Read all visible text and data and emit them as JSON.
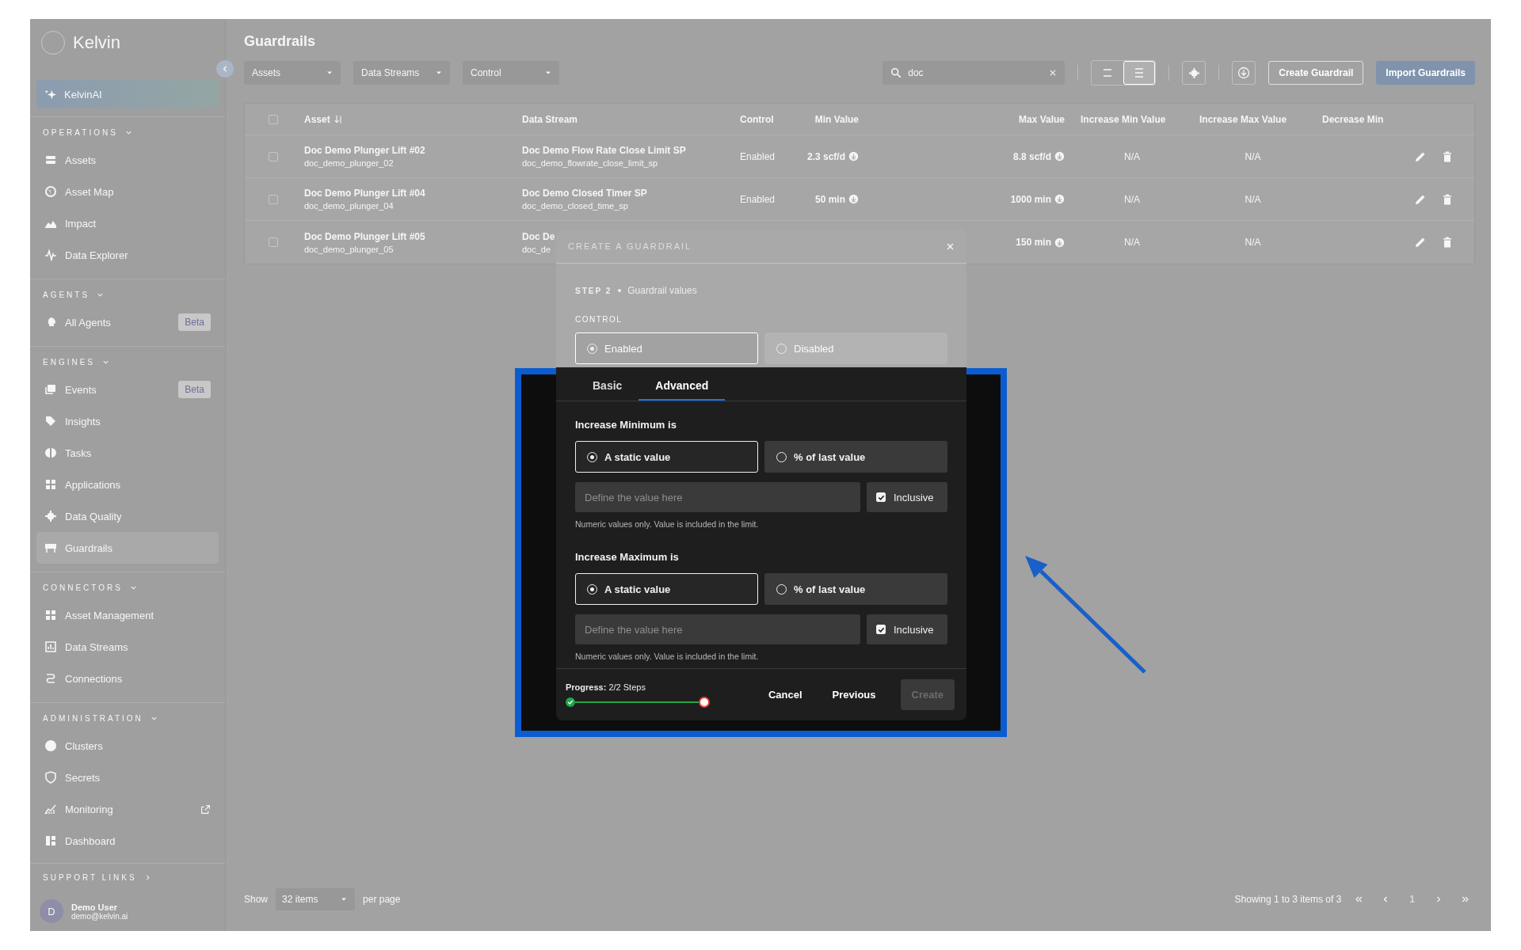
{
  "sidebar": {
    "logo": "Kelvin",
    "ai_item": {
      "label": "KelvinAI"
    },
    "sections": [
      {
        "title": "OPERATIONS",
        "items": [
          {
            "label": "Assets",
            "selected": false
          },
          {
            "label": "Asset Map",
            "selected": false
          },
          {
            "label": "Impact",
            "selected": false
          },
          {
            "label": "Data Explorer",
            "selected": false
          }
        ]
      },
      {
        "title": "AGENTS",
        "items": [
          {
            "label": "All Agents",
            "selected": false,
            "badge": "Beta"
          }
        ]
      },
      {
        "title": "ENGINES",
        "items": [
          {
            "label": "Events",
            "selected": false,
            "badge": "Beta"
          },
          {
            "label": "Insights",
            "selected": false
          },
          {
            "label": "Tasks",
            "selected": false
          },
          {
            "label": "Applications",
            "selected": false
          },
          {
            "label": "Data Quality",
            "selected": false
          },
          {
            "label": "Guardrails",
            "selected": true
          }
        ]
      },
      {
        "title": "CONNECTORS",
        "items": [
          {
            "label": "Asset Management",
            "selected": false
          },
          {
            "label": "Data Streams",
            "selected": false
          },
          {
            "label": "Connections",
            "selected": false
          }
        ]
      },
      {
        "title": "ADMINISTRATION",
        "items": [
          {
            "label": "Clusters",
            "selected": false
          },
          {
            "label": "Secrets",
            "selected": false
          },
          {
            "label": "Monitoring",
            "selected": false,
            "external": true
          },
          {
            "label": "Dashboard",
            "selected": false
          }
        ]
      }
    ],
    "support": "SUPPORT LINKS",
    "user": {
      "initial": "D",
      "name": "Demo User",
      "email": "demo@kelvin.ai"
    }
  },
  "main": {
    "title": "Guardrails",
    "filters": [
      "Assets",
      "Data Streams",
      "Control"
    ],
    "search": {
      "value": "doc"
    },
    "view_toggle": [
      {
        "selected": false
      },
      {
        "selected": true
      }
    ],
    "buttons": [
      {
        "label": "Create Guardrail",
        "kind": "outline"
      },
      {
        "label": "Import Guardrails",
        "kind": "primary"
      }
    ]
  },
  "table": {
    "header_checked": false,
    "columns": [
      "Asset",
      "Data Stream",
      "Control",
      "Min Value",
      "Max Value",
      "Increase Min Value",
      "Increase Max Value",
      "Decrease Min"
    ],
    "rows": [
      {
        "checked": false,
        "asset": "Doc Demo Plunger Lift #02",
        "asset_id": "doc_demo_plunger_02",
        "data_stream": "Doc Demo Flow Rate Close Limit SP",
        "data_stream_id": "doc_demo_flowrate_close_limit_sp",
        "control": "Enabled",
        "min_value": "2.3 scf/d",
        "max_value": "8.8 scf/d",
        "increase_min": "N/A",
        "increase_max": "N/A"
      },
      {
        "checked": false,
        "asset": "Doc Demo Plunger Lift #04",
        "asset_id": "doc_demo_plunger_04",
        "data_stream": "Doc Demo Closed Timer SP",
        "data_stream_id": "doc_demo_closed_time_sp",
        "control": "Enabled",
        "min_value": "50 min",
        "max_value": "1000 min",
        "increase_min": "N/A",
        "increase_max": "N/A"
      },
      {
        "checked": false,
        "asset": "Doc Demo Plunger Lift #05",
        "asset_id": "doc_demo_plunger_05",
        "data_stream": "Doc De",
        "data_stream_id": "doc_de",
        "max_value": "150 min",
        "increase_min": "N/A",
        "increase_max": "N/A"
      }
    ]
  },
  "pagination": {
    "show_label": "Show",
    "page_size": "32 items",
    "per_page": "per page",
    "summary": "Showing 1 to 3 items of 3",
    "pages": [
      {
        "label": "1",
        "selected": true
      }
    ]
  },
  "modal": {
    "title": "CREATE A GUARDRAIL",
    "step_label": "STEP 2",
    "step_name": "Guardrail values",
    "control": {
      "label": "CONTROL",
      "options": [
        {
          "label": "Enabled",
          "selected": true
        },
        {
          "label": "Disabled",
          "selected": false
        }
      ]
    },
    "tabs": [
      {
        "label": "Basic",
        "selected": false
      },
      {
        "label": "Advanced",
        "selected": true
      }
    ],
    "sections": [
      {
        "title": "Increase Minimum is",
        "options": [
          {
            "label": "A static value",
            "selected": true
          },
          {
            "label": "% of last value",
            "selected": false
          }
        ],
        "input": {
          "placeholder": "Define the value here"
        },
        "inclusive": {
          "label": "Inclusive",
          "checked": true
        },
        "hint": "Numeric values only. Value is included in the limit."
      },
      {
        "title": "Increase Maximum is",
        "options": [
          {
            "label": "A static value",
            "selected": true
          },
          {
            "label": "% of last value",
            "selected": false
          }
        ],
        "input": {
          "placeholder": "Define the value here"
        },
        "inclusive": {
          "label": "Inclusive",
          "checked": true
        },
        "hint": "Numeric values only. Value is included in the limit."
      }
    ],
    "footer": {
      "progress": "**Progress:** 2/2 Steps",
      "level": 1,
      "buttons": [
        {
          "label": "Cancel",
          "kind": "text",
          "disabled": false
        },
        {
          "label": "Previous",
          "kind": "text",
          "disabled": false
        },
        {
          "label": "Create",
          "kind": "primary",
          "disabled": true
        }
      ]
    }
  }
}
